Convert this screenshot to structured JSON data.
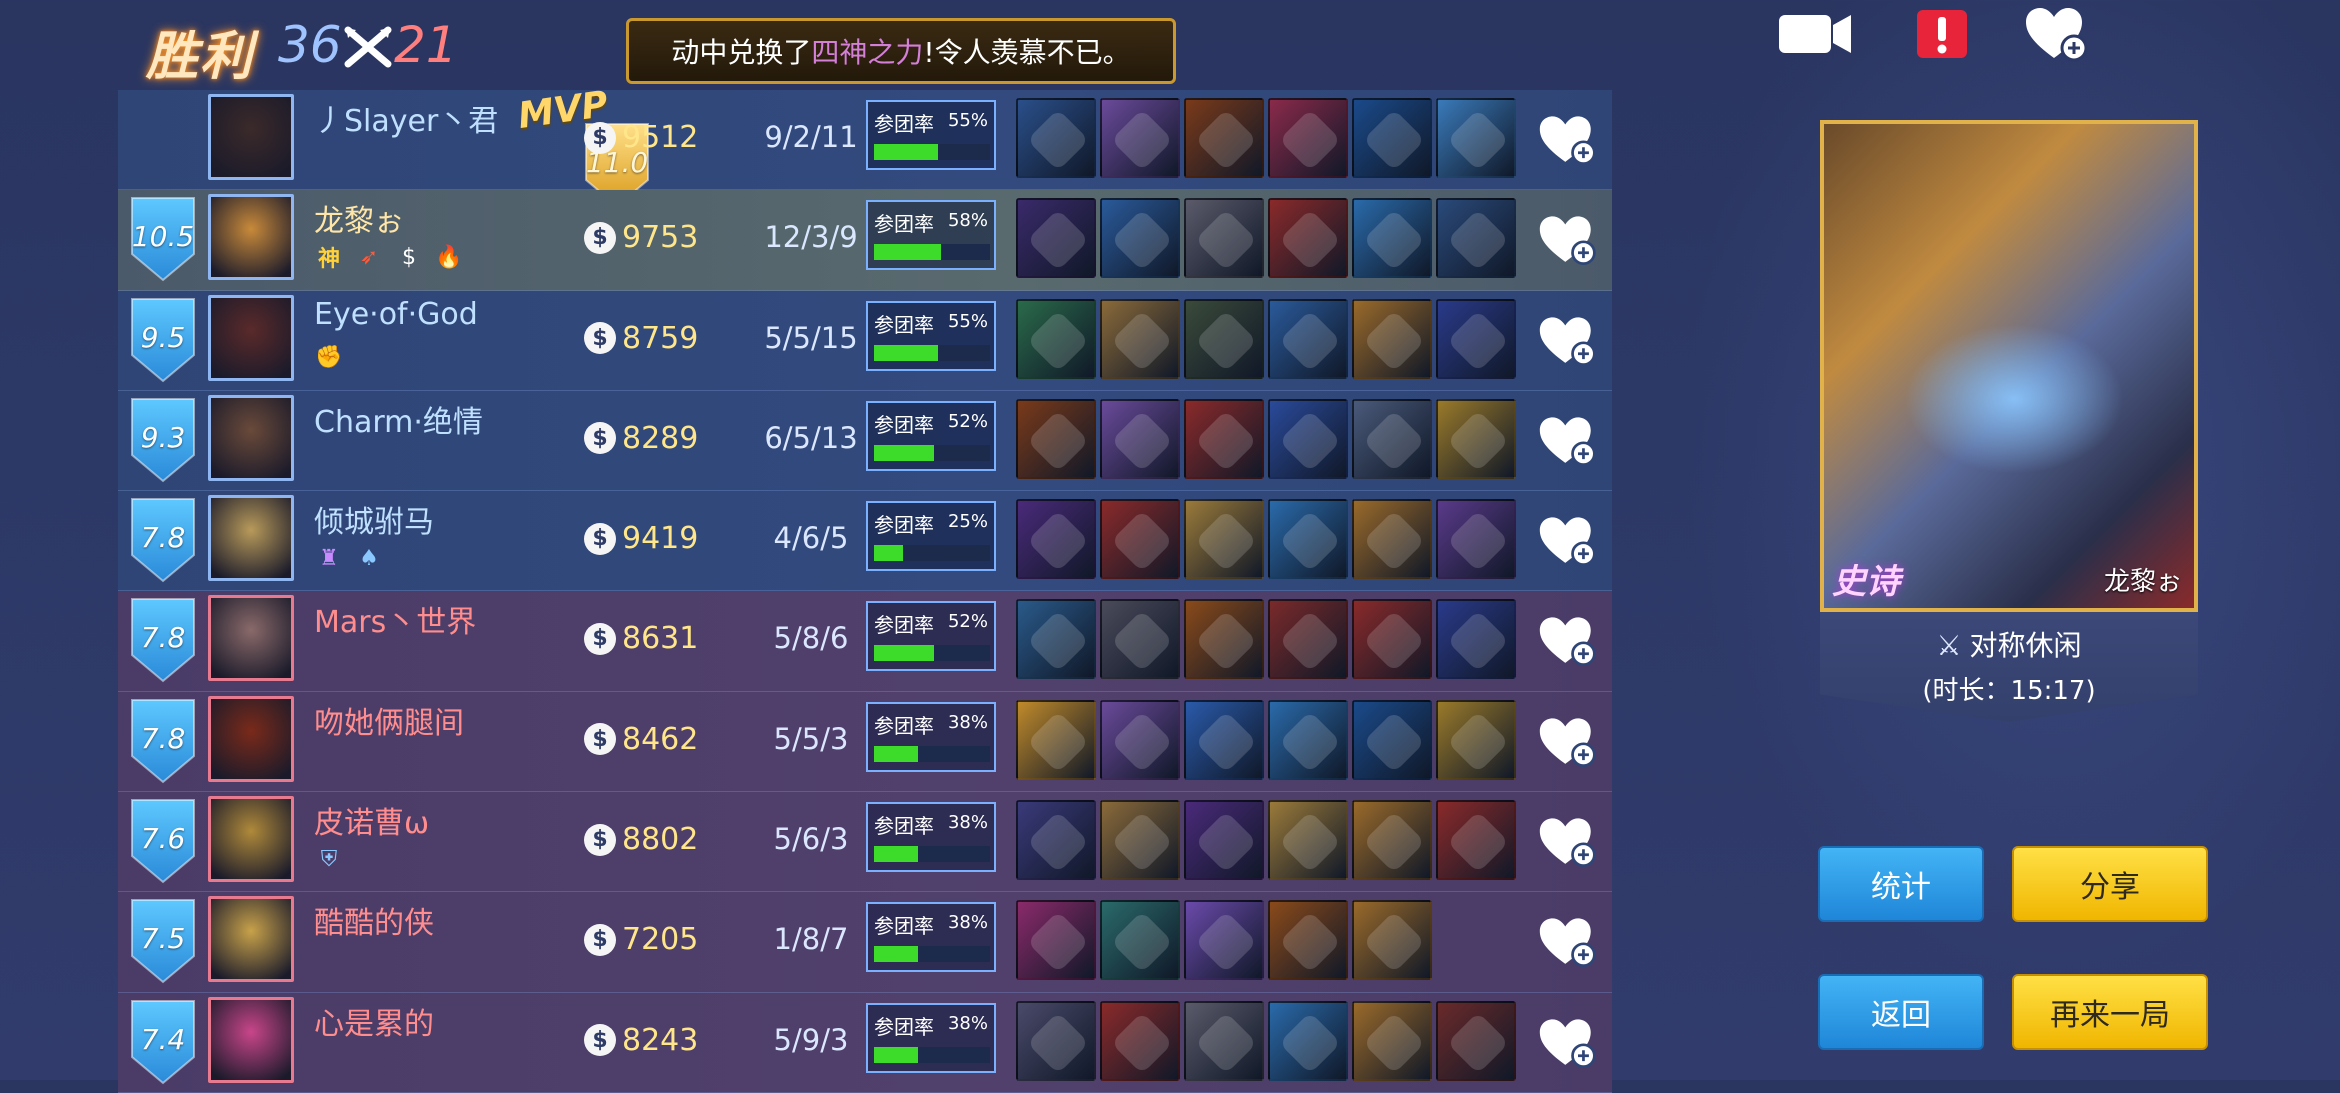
{
  "header": {
    "result": "胜利",
    "score_blue": "36",
    "score_red": "21",
    "banner_prefix": "动中兑换了",
    "banner_highlight": "四神之力",
    "banner_suffix": "!令人羡慕不已。"
  },
  "top_icons": [
    "video-record-icon",
    "report-icon",
    "like-all-icon"
  ],
  "players": [
    {
      "team": "blue",
      "rating": "11.0",
      "gold_shield": true,
      "name": "丿Slayer丶君",
      "mvp": "MVP",
      "gold": "9512",
      "kda": "9/2/11",
      "participation_label": "参团率",
      "participation": "55%",
      "participation_value": 55,
      "items": [
        "#2a4f8a",
        "#6a4a9a",
        "#7a3a1a",
        "#8a2a4a",
        "#1a4a8a",
        "#3a7aba"
      ],
      "badges": [],
      "avatar_color": "#3b2a2a",
      "selected": false
    },
    {
      "team": "blue",
      "rating": "10.5",
      "gold_shield": false,
      "name": "龙黎ぉ",
      "mvp": "",
      "gold": "9753",
      "kda": "12/3/9",
      "participation_label": "参团率",
      "participation": "58%",
      "participation_value": 58,
      "items": [
        "#3a2a6a",
        "#2a5a9a",
        "#5a5a6a",
        "#8a2a2a",
        "#2a6aaa",
        "#2a4a7a"
      ],
      "badges": [
        "神",
        "flame-icon",
        "coin-icon",
        "fire-icon"
      ],
      "avatar_color": "#c98a3a",
      "selected": true
    },
    {
      "team": "blue",
      "rating": "9.5",
      "gold_shield": false,
      "name": "Eye·of·God",
      "mvp": "",
      "gold": "8759",
      "kda": "5/5/15",
      "participation_label": "参团率",
      "participation": "55%",
      "participation_value": 55,
      "items": [
        "#2a6a4a",
        "#8a6a3a",
        "#3a4a3a",
        "#2a5a9a",
        "#9a6a2a",
        "#2a3a8a"
      ],
      "badges": [
        "fist-icon"
      ],
      "avatar_color": "#5a2a2a",
      "selected": false
    },
    {
      "team": "blue",
      "rating": "9.3",
      "gold_shield": false,
      "name": "Charm·绝情",
      "mvp": "",
      "gold": "8289",
      "kda": "6/5/13",
      "participation_label": "参团率",
      "participation": "52%",
      "participation_value": 52,
      "items": [
        "#7a3a1a",
        "#6a4a9a",
        "#8a2a2a",
        "#2a4a9a",
        "#4a5a7a",
        "#9a7a2a"
      ],
      "badges": [],
      "avatar_color": "#6a4a3a",
      "selected": false
    },
    {
      "team": "blue",
      "rating": "7.8",
      "gold_shield": false,
      "name": "倾城驸马",
      "mvp": "",
      "gold": "9419",
      "kda": "4/6/5",
      "participation_label": "参团率",
      "participation": "25%",
      "participation_value": 25,
      "items": [
        "#4a2a7a",
        "#8a2a2a",
        "#9a7a3a",
        "#2a6aaa",
        "#9a6a2a",
        "#5a3a8a"
      ],
      "badges": [
        "rook-icon",
        "hood-icon"
      ],
      "avatar_color": "#b89a5a",
      "selected": false
    },
    {
      "team": "red",
      "rating": "7.8",
      "gold_shield": false,
      "name": "Mars丶世界",
      "mvp": "",
      "gold": "8631",
      "kda": "5/8/6",
      "participation_label": "参团率",
      "participation": "52%",
      "participation_value": 52,
      "items": [
        "#2a5a8a",
        "#4a4a5a",
        "#8a4a1a",
        "#7a2a2a",
        "#8a2a2a",
        "#2a3a8a"
      ],
      "badges": [],
      "avatar_color": "#8a6a6a",
      "selected": false
    },
    {
      "team": "red",
      "rating": "7.8",
      "gold_shield": false,
      "name": "吻她俩腿间",
      "mvp": "",
      "gold": "8462",
      "kda": "5/5/3",
      "participation_label": "参团率",
      "participation": "38%",
      "participation_value": 38,
      "items": [
        "#c08a2a",
        "#6a4a9a",
        "#2a5aaa",
        "#2a6aaa",
        "#1a4a8a",
        "#9a7a2a"
      ],
      "badges": [],
      "avatar_color": "#7a2a1a",
      "selected": false
    },
    {
      "team": "red",
      "rating": "7.6",
      "gold_shield": false,
      "name": "皮诺曹ω",
      "mvp": "",
      "gold": "8802",
      "kda": "5/6/3",
      "participation_label": "参团率",
      "participation": "38%",
      "participation_value": 38,
      "items": [
        "#3a3a7a",
        "#8a6a3a",
        "#4a2a7a",
        "#9a7a3a",
        "#9a6a2a",
        "#8a2a2a"
      ],
      "badges": [
        "shield-icon"
      ],
      "avatar_color": "#b08a3a",
      "selected": false
    },
    {
      "team": "red",
      "rating": "7.5",
      "gold_shield": false,
      "name": "酷酷的侠",
      "mvp": "",
      "gold": "7205",
      "kda": "1/8/7",
      "participation_label": "参团率",
      "participation": "38%",
      "participation_value": 38,
      "items": [
        "#8a2a6a",
        "#2a6a6a",
        "#6a4aaa",
        "#8a4a1a",
        "#9a6a2a",
        ""
      ],
      "badges": [],
      "avatar_color": "#c8a24a",
      "selected": false
    },
    {
      "team": "red",
      "rating": "7.4",
      "gold_shield": false,
      "name": "心是累的",
      "mvp": "",
      "gold": "8243",
      "kda": "5/9/3",
      "participation_label": "参团率",
      "participation": "38%",
      "participation_value": 38,
      "items": [
        "#4a4a6a",
        "#8a2a2a",
        "#5a5a6a",
        "#2a6aaa",
        "#9a6a2a",
        "#6a2a2a"
      ],
      "badges": [],
      "avatar_color": "#c8468a",
      "selected": false
    }
  ],
  "hero_card": {
    "rarity": "史诗",
    "hero_name": "龙黎ぉ",
    "mode": "对称休闲",
    "duration": "(时长：15:17)"
  },
  "buttons": {
    "stats": "统计",
    "share": "分享",
    "back": "返回",
    "again": "再来一局"
  },
  "colors": {
    "accent_gold": "#e2b24a",
    "participation_fill": "#3ddc2a",
    "blue_team": "#9fc3ff",
    "red_team": "#ff7e7e"
  }
}
